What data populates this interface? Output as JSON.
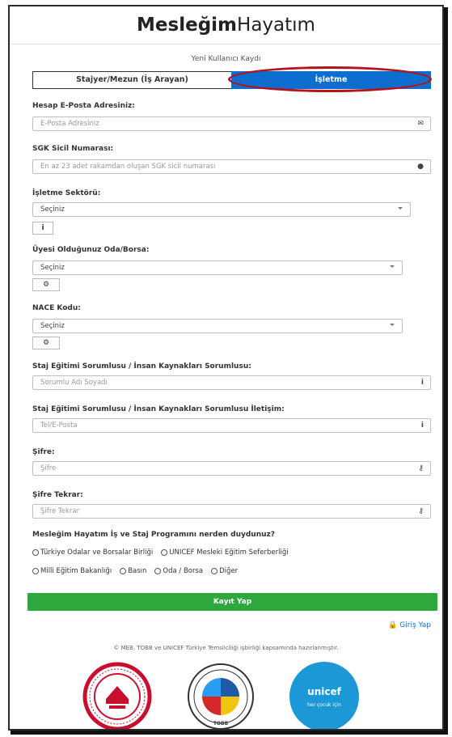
{
  "brand": {
    "bold": "Mesleğim",
    "light": "Hayatım"
  },
  "subtitle": "Yeni Kullanıcı Kaydı",
  "tabs": {
    "seeker": "Stajyer/Mezun (İş Arayan)",
    "business": "İşletme"
  },
  "fields": {
    "email": {
      "label": "Hesap E-Posta Adresiniz:",
      "placeholder": "E-Posta Adresiniz"
    },
    "sgk": {
      "label": "SGK Sicil Numarası:",
      "placeholder": "En az 23 adet rakamdan oluşan SGK sicil numarası"
    },
    "sector": {
      "label": "İşletme Sektörü:",
      "value": "Seçiniz"
    },
    "chamber": {
      "label": "Üyesi Olduğunuz Oda/Borsa:",
      "value": "Seçiniz"
    },
    "nace": {
      "label": "NACE Kodu:",
      "value": "Seçiniz"
    },
    "responsible": {
      "label": "Staj Eğitimi Sorumlusu / İnsan Kaynakları Sorumlusu:",
      "placeholder": "Sorumlu Adı Soyadı"
    },
    "contact": {
      "label": "Staj Eğitimi Sorumlusu / İnsan Kaynakları Sorumlusu İletişim:",
      "placeholder": "Tel/E-Posta"
    },
    "password": {
      "label": "Şifre:",
      "placeholder": "Şifre"
    },
    "password2": {
      "label": "Şifre Tekrar:",
      "placeholder": "Şifre Tekrar"
    }
  },
  "question": "Mesleğim Hayatım İş ve Staj Programını nerden duydunuz?",
  "radios_row1": [
    "Türkiye Odalar ve Borsalar Birliği",
    "UNICEF Mesleki Eğitim Seferberliği"
  ],
  "radios_row2": [
    "Milli Eğitim Bakanlığı",
    "Basın",
    "Oda / Borsa",
    "Diğer"
  ],
  "submit": "Kayıt Yap",
  "login": "Giriş Yap",
  "footer": "© MEB, TOBB ve UNICEF Türkiye Temsilciliği işbirliği kapsamında hazırlanmıştır.",
  "logos": {
    "unicef": "unicef",
    "unicef_sub": "her çocuk için",
    "tobb": "TOBB"
  },
  "colors": {
    "primary": "#0d6ecf",
    "success": "#2ea83c",
    "highlight": "#b3151b"
  }
}
